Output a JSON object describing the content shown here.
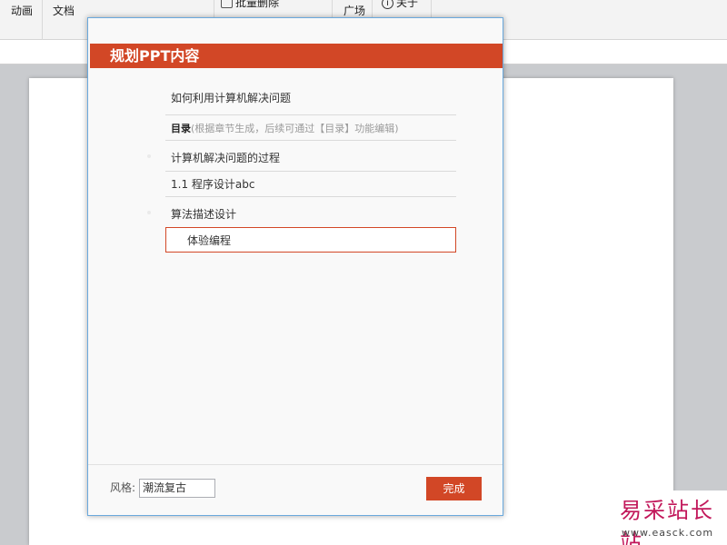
{
  "ribbon": {
    "g1": [
      "动画"
    ],
    "g2": [
      "文档"
    ],
    "g3_label": "批量删除",
    "g4": [
      "广场"
    ],
    "about": "关于"
  },
  "dialog": {
    "title": "规划PPT内容",
    "outline": [
      {
        "text": "如何利用计算机解决问题"
      },
      {
        "toc_label": "目录",
        "toc_hint": "(根据章节生成，后续可通过【目录】功能编辑)"
      },
      {
        "text": "计算机解决问题的过程"
      },
      {
        "text": "1.1 程序设计abc"
      },
      {
        "text": "算法描述设计"
      },
      {
        "text": "体验编程"
      }
    ],
    "style_label": "风格:",
    "style_value": "潮流复古",
    "done_button": "完成"
  },
  "watermark": {
    "text": "易采站长站",
    "url": "www.easck.com"
  },
  "colors": {
    "accent": "#d24726",
    "dialog_border": "#6aa9dd",
    "watermark": "#c2185b"
  }
}
